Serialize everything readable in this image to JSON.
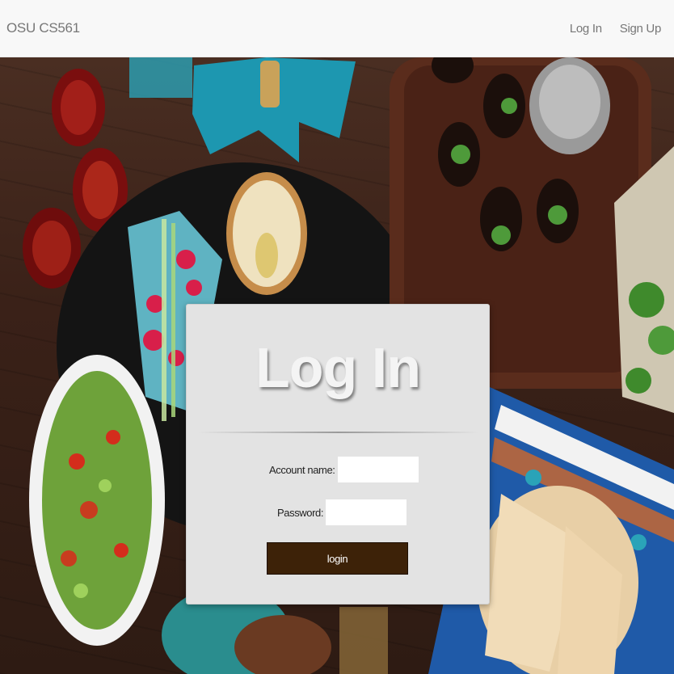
{
  "navbar": {
    "brand": "OSU CS561",
    "links": [
      "Log In",
      "Sign Up"
    ]
  },
  "login": {
    "title": "Log In",
    "account_label": "Account name:",
    "account_value": "",
    "password_label": "Password:",
    "password_value": "",
    "submit_label": "login"
  },
  "colors": {
    "navbar_bg": "#f8f8f8",
    "panel_bg": "#e3e3e3",
    "button_bg": "#3d2208"
  }
}
